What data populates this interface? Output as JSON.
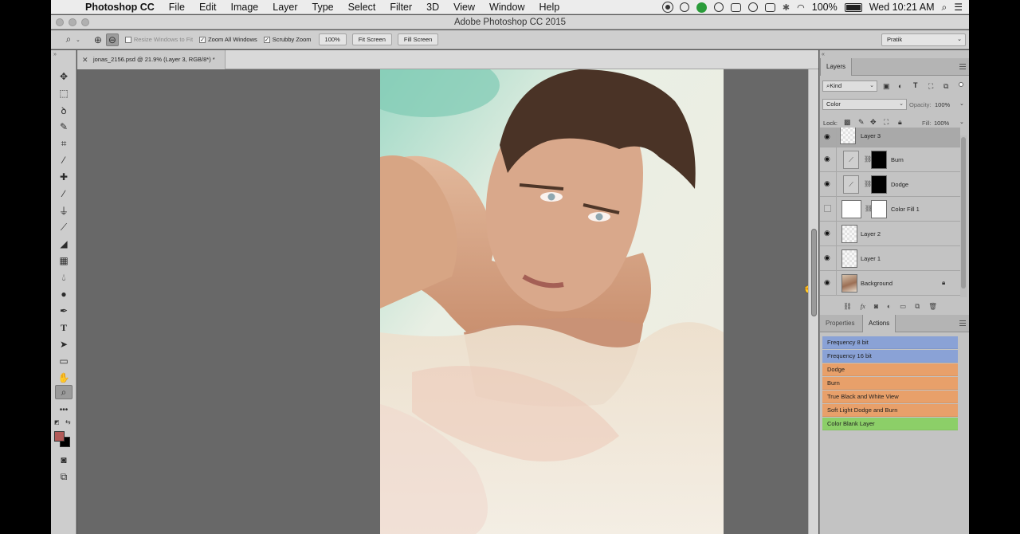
{
  "menubar": {
    "app_name": "Photoshop CC",
    "items": [
      "File",
      "Edit",
      "Image",
      "Layer",
      "Type",
      "Select",
      "Filter",
      "3D",
      "View",
      "Window",
      "Help"
    ],
    "battery": "100%",
    "clock": "Wed 10:21 AM"
  },
  "window": {
    "title": "Adobe Photoshop CC 2015"
  },
  "options": {
    "resize_windows": "Resize Windows to Fit",
    "zoom_all": "Zoom All Windows",
    "scrubby": "Scrubby Zoom",
    "percent": "100%",
    "fit_screen": "Fit Screen",
    "fill_screen": "Fill Screen",
    "workspace": "Pratik"
  },
  "document": {
    "tab": "jonas_2156.psd @ 21.9% (Layer 3, RGB/8*) *"
  },
  "layers_panel": {
    "tab": "Layers",
    "filter_kind": "Kind",
    "blend_mode": "Color",
    "opacity_label": "Opacity:",
    "opacity": "100%",
    "lock_label": "Lock:",
    "fill_label": "Fill:",
    "fill": "100%",
    "layers": [
      {
        "name": "Layer 3",
        "visible": true,
        "selected": true
      },
      {
        "name": "Burn",
        "visible": true
      },
      {
        "name": "Dodge",
        "visible": true
      },
      {
        "name": "Color Fill 1",
        "visible": false
      },
      {
        "name": "Layer 2",
        "visible": true
      },
      {
        "name": "Layer 1",
        "visible": true
      },
      {
        "name": "Background",
        "visible": true,
        "locked": true
      }
    ]
  },
  "bottom_panel": {
    "tabs": [
      "Properties",
      "Actions"
    ],
    "active_tab": "Actions",
    "actions": [
      {
        "name": "Frequency 8 bit",
        "color": "#8aa2d6"
      },
      {
        "name": "Frequency 16 bit",
        "color": "#8aa2d6"
      },
      {
        "name": "Dodge",
        "color": "#e8a06a"
      },
      {
        "name": "Burn",
        "color": "#e8a06a"
      },
      {
        "name": "True Black and White View",
        "color": "#e8a06a"
      },
      {
        "name": "Soft Light Dodge and Burn",
        "color": "#e8a06a"
      },
      {
        "name": "Color Blank Layer",
        "color": "#8ccf68"
      }
    ]
  },
  "colors": {
    "foreground": "#b25a58",
    "background": "#000000"
  }
}
